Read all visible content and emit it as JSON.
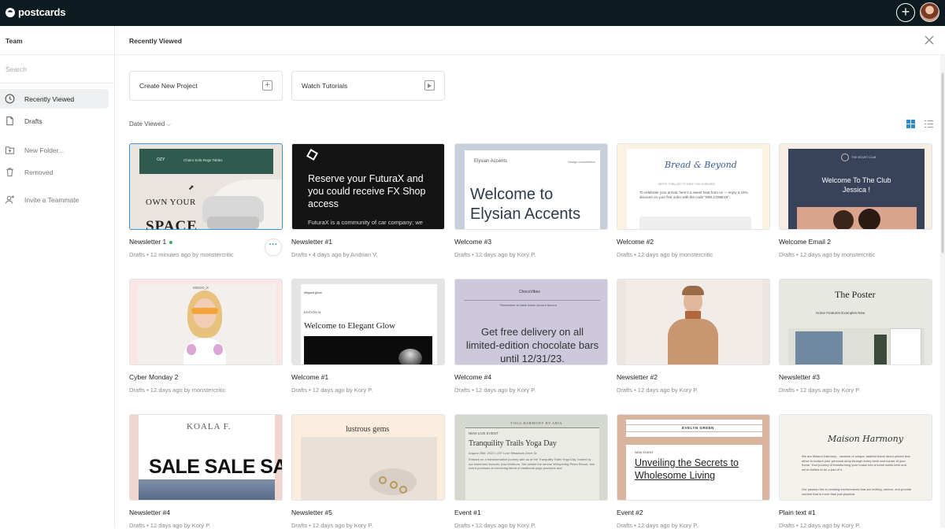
{
  "app": {
    "brand": "postcards"
  },
  "sidebar": {
    "section": "Team",
    "search_placeholder": "Search",
    "items": [
      {
        "label": "Recently Viewed",
        "icon": "clock-icon"
      },
      {
        "label": "Drafts",
        "icon": "document-icon"
      },
      {
        "label": "New Folder...",
        "icon": "folder-plus-icon"
      },
      {
        "label": "Removed",
        "icon": "trash-icon"
      },
      {
        "label": "Invite a Teammate",
        "icon": "user-plus-icon"
      }
    ]
  },
  "main": {
    "title": "Recently Viewed",
    "actions": [
      {
        "label": "Create New Project"
      },
      {
        "label": "Watch Tutorials"
      }
    ],
    "sort_label": "Date Viewed"
  },
  "cards": [
    {
      "title": "Newsletter 1",
      "meta": "Drafts  •  12 minutes ago by monstercritic",
      "thumb": {
        "nav": "Chairs   Sofa   Rugs   Tables",
        "brand": "OZY",
        "headline": "OWN YOUR",
        "headline2": "SPACE"
      }
    },
    {
      "title": "Newsletter #1",
      "meta": "Drafts  •  4 days ago by Andrian V.",
      "thumb": {
        "headline": "Reserve your FuturaX and you could receive FX Shop access",
        "body": "FuturaX is a community of car company; we"
      }
    },
    {
      "title": "Welcome #3",
      "meta": "Drafts  •  12 days ago by Kory P.",
      "thumb": {
        "brand": "Elysian Accents",
        "nav": "Design consultation",
        "headline": "Welcome to Elysian Accents"
      }
    },
    {
      "title": "Welcome #2",
      "meta": "Drafts  •  12 days ago by monstercritic",
      "thumb": {
        "brand": "Bread & Beyond",
        "tag": "WE'RE THRILLED TO HAVE YOU ONBOARD",
        "body": "To celebrate your arrival, here's a sweet treat from us — enjoy a 15% discount on your first order with the code \"WELCOME15\"."
      }
    },
    {
      "title": "Welcome Email 2",
      "meta": "Drafts  •  12 days ago by monstercritic",
      "thumb": {
        "brand": "THE VELVET CLUB",
        "headline": "Welcome To The Club Jessica !"
      }
    },
    {
      "title": "Cyber Monday 2",
      "meta": "Drafts  •  12 days ago by monstercritic",
      "thumb": {
        "brand": "MISSO_X"
      }
    },
    {
      "title": "Welcome #1",
      "meta": "Drafts  •  12 days ago by Kory P.",
      "thumb": {
        "brand": "elegant glow",
        "tag": "EDITION 01",
        "headline": "Welcome to Elegant Glow"
      }
    },
    {
      "title": "Welcome #4",
      "meta": "Drafts  •  12 days ago by Kory P.",
      "thumb": {
        "brand": "ChocoVibes",
        "tag": "Remember to taste these chosen flavors.",
        "headline": "Get free delivery on all limited-edition chocolate bars until 12/31/23."
      }
    },
    {
      "title": "Newsletter #2",
      "meta": "Drafts  •  12 days ago by Kory P.",
      "thumb": {}
    },
    {
      "title": "Newsletter #3",
      "meta": "Drafts  •  12 days ago by Kory P.",
      "thumb": {
        "headline": "The Poster",
        "nav": "Home    Features    Examples    New"
      }
    },
    {
      "title": "Newsletter #4",
      "meta": "Drafts  •  12 days ago by Kory P.",
      "thumb": {
        "brand": "KOALA F.",
        "headline": "SALE SALE SALE"
      }
    },
    {
      "title": "Newsletter #5",
      "meta": "Drafts  •  12 days ago by Kory P.",
      "thumb": {
        "headline": "lustrous gems"
      }
    },
    {
      "title": "Event #1",
      "meta": "Drafts  •  12 days ago by Kory P.",
      "thumb": {
        "brand": "YOGA HARMONY BY ARIA",
        "tag": "NEW LIVE EVENT",
        "headline": "Tranquility Trails Yoga Day",
        "date": "August 25th, 2023 • 287 Lush Meadows Drive St.",
        "body": "Embark on a transformative journey with us at the Tranquility Trails Yoga Day, hosted by our esteemed founder, Aria Winthorn. Set amidst the serene Whispering Pines Resort, this event promises an enriching blend of traditional yoga practices and"
      }
    },
    {
      "title": "Event #2",
      "meta": "Drafts  •  12 days ago by Kory P.",
      "thumb": {
        "brand": "EVELYN GREEN",
        "tag": "NEW EVENT",
        "headline": "Unveiling the Secrets to Wholesome Living"
      }
    },
    {
      "title": "Plain text #1",
      "meta": "Drafts  •  12 days ago by Kory P.",
      "thumb": {
        "headline": "Maison Harmony",
        "body": "We are Maison Harmony - creators of unique, tasteful home decor pieces that strive to nurture your personal story through every nook and corner of your home. Your journey of transforming your house into a home starts here and we're thrilled to be a part of it.",
        "body2": "Our passion lies in creating environments that are inviting, serene, and provide comfort that is more than just physical."
      }
    }
  ],
  "colors": {
    "topbar": "#0c1b1f",
    "accent": "#2e8bc8",
    "online": "#33b45a"
  }
}
